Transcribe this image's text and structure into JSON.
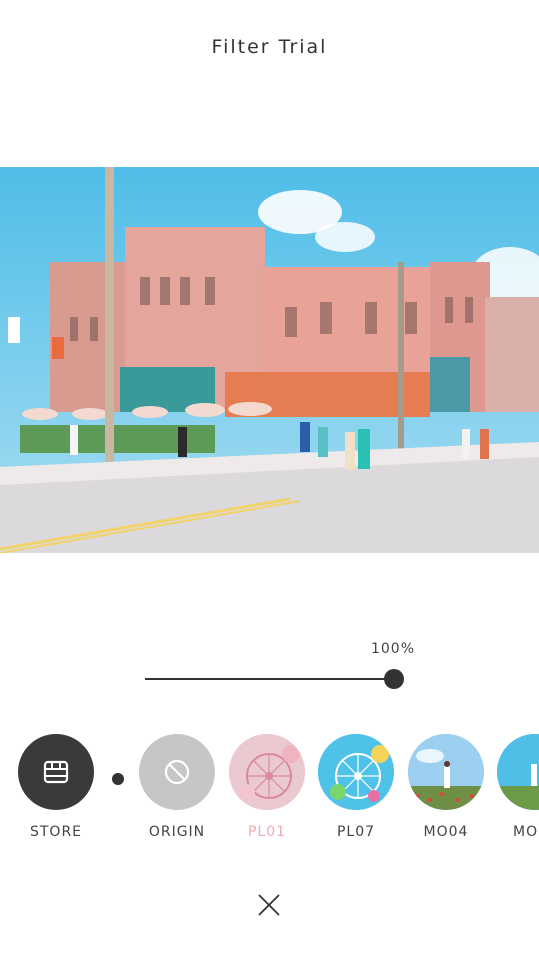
{
  "header": {
    "title": "Filter Trial"
  },
  "photo": {
    "icon": "street-photo-preview"
  },
  "intensity": {
    "label": "100%",
    "value": 1.0
  },
  "filters": [
    {
      "label": "STORE",
      "icon": "store-icon",
      "selected": false
    },
    {
      "label": "ORIGIN",
      "icon": "prohibited-icon",
      "selected": false
    },
    {
      "label": "PL01",
      "icon": "ferris-wheel-thumb",
      "selected": true
    },
    {
      "label": "PL07",
      "icon": "ferris-wheel-thumb",
      "selected": false
    },
    {
      "label": "MO04",
      "icon": "field-thumb",
      "selected": false
    },
    {
      "label": "MO",
      "icon": "field-thumb",
      "selected": false
    }
  ],
  "footer": {
    "close_icon": "close-icon"
  },
  "colors": {
    "dark": "#3a3a3a",
    "origin_gray": "#c6c6c6",
    "selected_pink": "#f0a9b4",
    "sky": "#5bc7ec"
  }
}
